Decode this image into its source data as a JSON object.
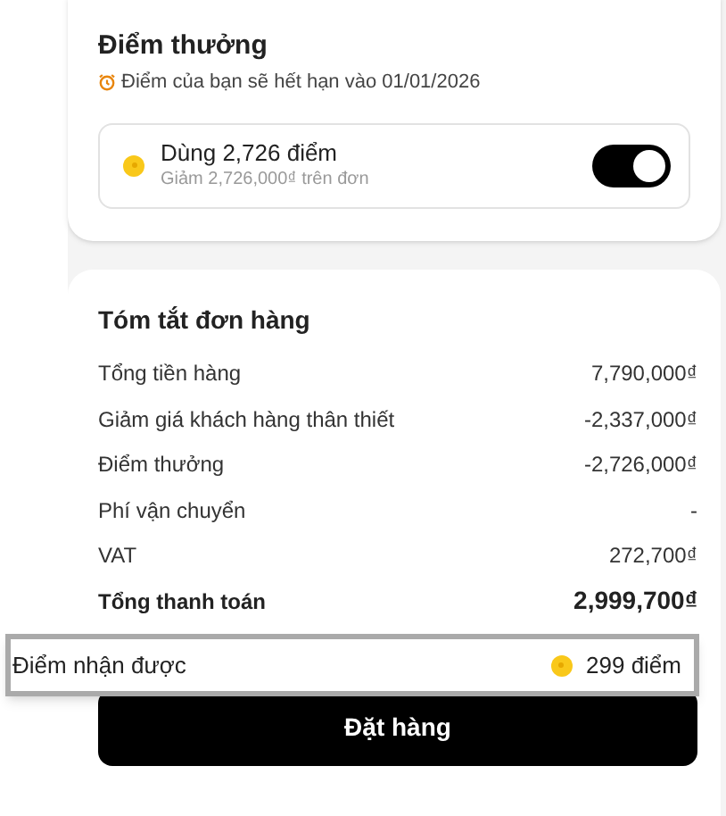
{
  "rewards": {
    "title": "Điểm thưởng",
    "expiry_note": "Điểm của bạn sẽ hết hạn vào 01/01/2026",
    "use_points": {
      "label": "Dùng 2,726 điểm",
      "sublabel": "Giảm 2,726,000₫ trên đơn",
      "on": true
    }
  },
  "summary": {
    "title": "Tóm tắt đơn hàng",
    "rows": [
      {
        "label": "Tổng tiền hàng",
        "value": "7,790,000₫",
        "kind": "line"
      },
      {
        "label": "Giảm giá khách hàng thân thiết",
        "value": "-2,337,000₫",
        "kind": "line"
      },
      {
        "label": "Điểm thưởng",
        "value": "-2,726,000₫",
        "kind": "line"
      },
      {
        "label": "Phí vận chuyển",
        "value": "-",
        "kind": "line"
      },
      {
        "label": "VAT",
        "value": "272,700₫",
        "kind": "line"
      },
      {
        "label": "Tổng thanh toán",
        "value": "2,999,700₫",
        "kind": "total"
      }
    ],
    "points_earned": {
      "label": "Điểm nhận được",
      "value": "299 điểm"
    },
    "button": "Đặt hàng"
  }
}
